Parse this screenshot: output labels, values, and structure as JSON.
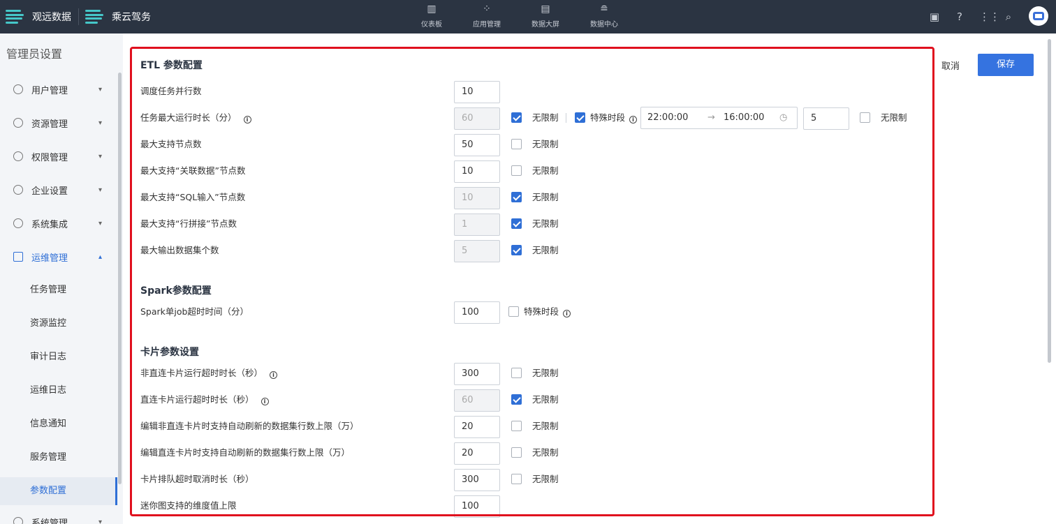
{
  "topbar": {
    "brand1": "观远数据",
    "brand2": "乘云驾务",
    "nav": [
      {
        "label": "仪表板",
        "icon": "dashboard-icon"
      },
      {
        "label": "应用管理",
        "icon": "apps-icon"
      },
      {
        "label": "数据大屏",
        "icon": "big-screen-icon"
      },
      {
        "label": "数据中心",
        "icon": "database-icon"
      }
    ]
  },
  "sidebar": {
    "title": "管理员设置",
    "menus": [
      {
        "label": "用户管理"
      },
      {
        "label": "资源管理"
      },
      {
        "label": "权限管理"
      },
      {
        "label": "企业设置"
      },
      {
        "label": "系统集成"
      },
      {
        "label": "运维管理"
      },
      {
        "label": "系统管理"
      }
    ],
    "subs": [
      {
        "label": "任务管理"
      },
      {
        "label": "资源监控"
      },
      {
        "label": "审计日志"
      },
      {
        "label": "运维日志"
      },
      {
        "label": "信息通知"
      },
      {
        "label": "服务管理"
      },
      {
        "label": "参数配置"
      }
    ]
  },
  "actions": {
    "cancel": "取消",
    "save": "保存"
  },
  "unlimited": "无限制",
  "special_period": "特殊时段",
  "etl": {
    "title": "ETL 参数配置",
    "rows": [
      {
        "label": "调度任务并行数",
        "value": "10",
        "disabled": false
      },
      {
        "label": "任务最大运行时长（分）",
        "value": "60",
        "disabled": true,
        "unlimited": true
      },
      {
        "label": "最大支持节点数",
        "value": "50",
        "disabled": false,
        "unlimited": false
      },
      {
        "label": "最大支持“关联数据”节点数",
        "value": "10",
        "disabled": false,
        "unlimited": false
      },
      {
        "label": "最大支持“SQL输入”节点数",
        "value": "10",
        "disabled": true,
        "unlimited": true
      },
      {
        "label": "最大支持“行拼接”节点数",
        "value": "1",
        "disabled": true,
        "unlimited": true
      },
      {
        "label": "最大输出数据集个数",
        "value": "5",
        "disabled": true,
        "unlimited": true
      }
    ],
    "special": {
      "start": "22:00:00",
      "end": "16:00:00",
      "value": "5",
      "checked": true,
      "unlimited": false
    }
  },
  "spark": {
    "title": "Spark参数配置",
    "row": {
      "label": "Spark单job超时时间（分）",
      "value": "100"
    }
  },
  "card": {
    "title": "卡片参数设置",
    "rows": [
      {
        "label": "非直连卡片运行超时时长（秒）",
        "value": "300",
        "disabled": false,
        "unlimited": false
      },
      {
        "label": "直连卡片运行超时时长（秒）",
        "value": "60",
        "disabled": true,
        "unlimited": true
      },
      {
        "label": "编辑非直连卡片时支持自动刷新的数据集行数上限（万）",
        "value": "20",
        "disabled": false,
        "unlimited": false
      },
      {
        "label": "编辑直连卡片时支持自动刷新的数据集行数上限（万）",
        "value": "20",
        "disabled": false,
        "unlimited": false
      },
      {
        "label": "卡片排队超时取消时长（秒）",
        "value": "300",
        "disabled": false,
        "unlimited": false
      },
      {
        "label": "迷你图支持的维度值上限",
        "value": "100",
        "disabled": false
      }
    ]
  }
}
